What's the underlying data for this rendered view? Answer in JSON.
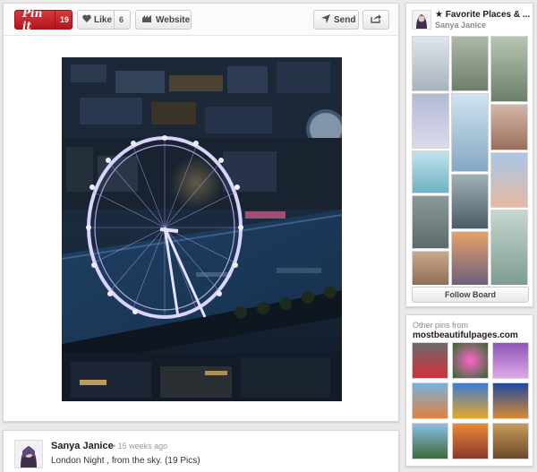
{
  "toolbar": {
    "pinit_label": "Pin it",
    "pinit_count": "19",
    "like_label": "Like",
    "like_count": "6",
    "website_label": "Website",
    "send_label": "Send"
  },
  "author": {
    "name": "Sanya Janice",
    "time": "• 15 weeks ago",
    "description": "London Night , from the sky. (19 Pics)"
  },
  "board": {
    "title": "★ Favorite Places & ...",
    "owner": "Sanya Janice",
    "follow_label": "Follow Board"
  },
  "other_pins": {
    "heading": "Other pins from",
    "domain": "mostbeautifulpages.com"
  },
  "colors": {
    "pinit_red": "#c8232c",
    "background": "#ebe9e9"
  }
}
